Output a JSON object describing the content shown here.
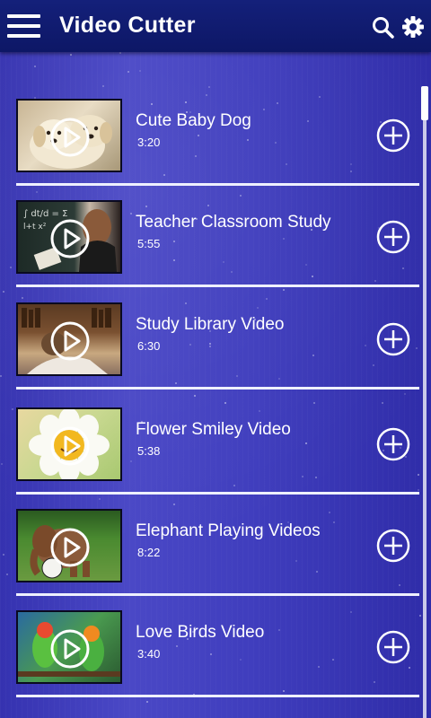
{
  "app": {
    "title": "Video Cutter"
  },
  "header": {
    "menu_icon": "hamburger-icon",
    "search_icon": "search-icon",
    "settings_icon": "gear-icon"
  },
  "videos": [
    {
      "title": "Cute Baby Dog",
      "duration": "3:20",
      "thumb": "puppy"
    },
    {
      "title": "Teacher Classroom Study",
      "duration": "5:55",
      "thumb": "classroom"
    },
    {
      "title": "Study Library Video",
      "duration": "6:30",
      "thumb": "library"
    },
    {
      "title": "Flower Smiley Video",
      "duration": "5:38",
      "thumb": "flower"
    },
    {
      "title": "Elephant Playing Videos",
      "duration": "8:22",
      "thumb": "elephant"
    },
    {
      "title": "Love Birds Video",
      "duration": "3:40",
      "thumb": "birds"
    }
  ],
  "colors": {
    "topbar": "#14207a",
    "background": "#3a3ab8",
    "text": "#ffffff"
  }
}
